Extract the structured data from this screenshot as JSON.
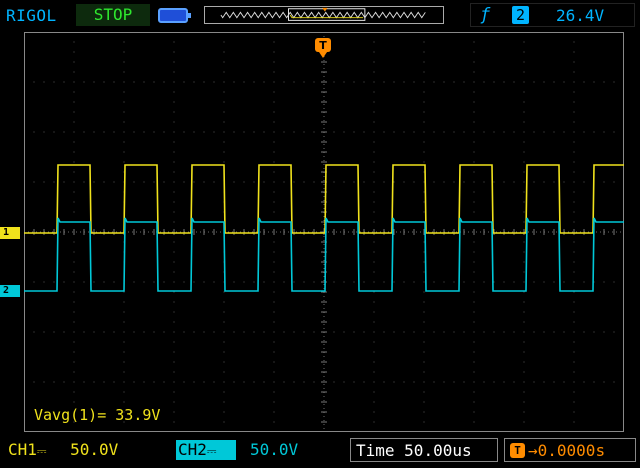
{
  "header": {
    "brand": "RIGOL",
    "run_state": "STOP",
    "trigger_source": "2",
    "trigger_level": "26.4V"
  },
  "channels": {
    "ch1": {
      "label": "CH1",
      "scale": "50.0V",
      "marker": "1",
      "color": "#f0e21c"
    },
    "ch2": {
      "label": "CH2",
      "scale": "50.0V",
      "marker": "2",
      "color": "#00c8d8"
    }
  },
  "timebase": {
    "label": "Time",
    "scale": "50.00us"
  },
  "trigger_offset": "0.0000s",
  "measurement": "Vavg(1)= 33.9V",
  "trigger_marker": "T",
  "colors": {
    "brand": "#00b4ff",
    "stop": "#2ee82e",
    "trigger": "#ff8c00",
    "grid": "#5a5a5a"
  },
  "icons": [
    "battery-icon",
    "trigger-edge-icon",
    "trigger-position-icon",
    "dc-coupling-icon"
  ]
}
